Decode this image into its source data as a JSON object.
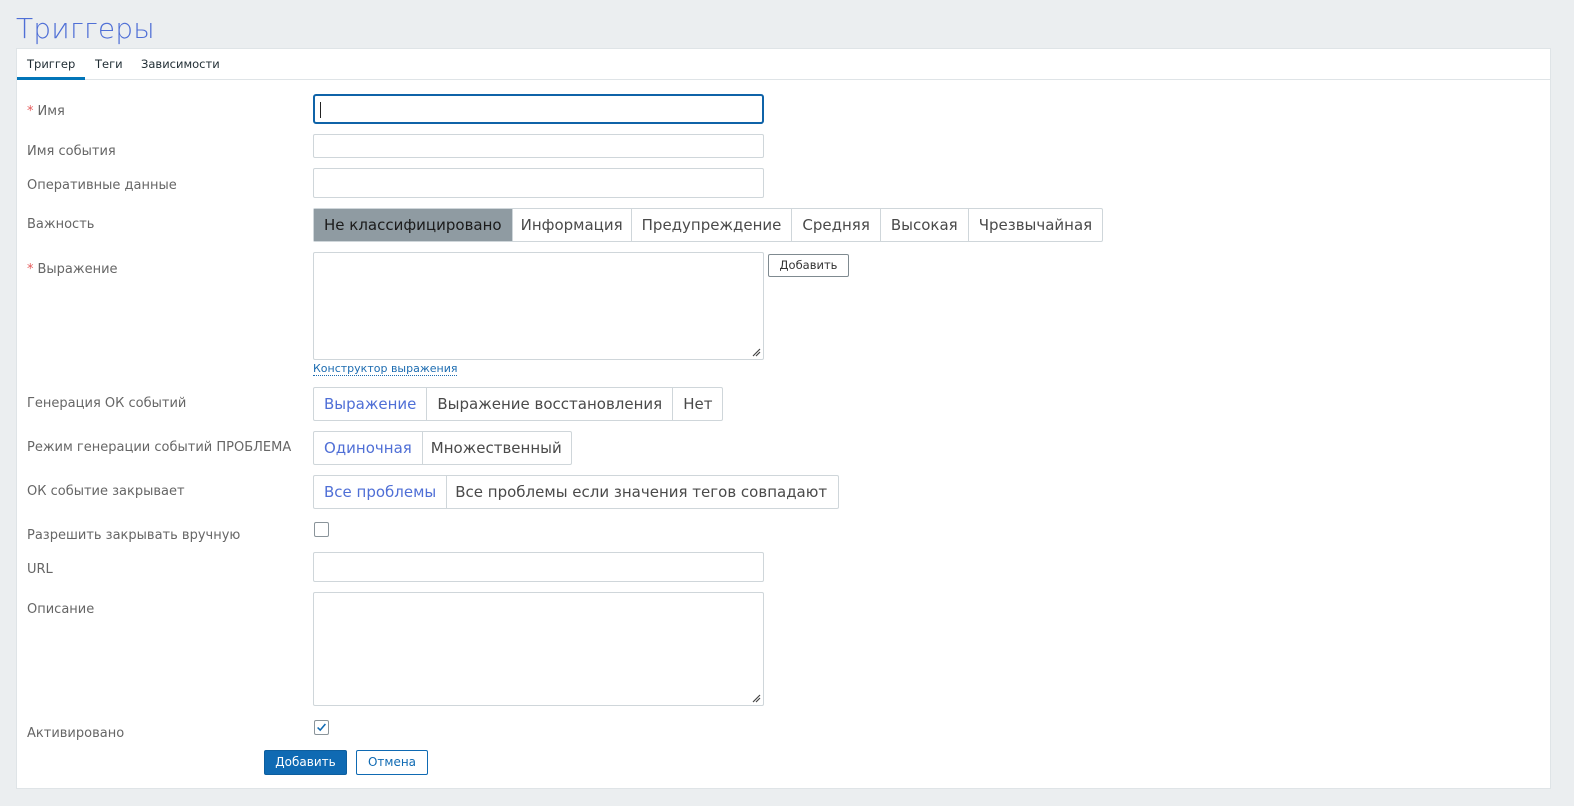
{
  "page": {
    "title": "Триггеры"
  },
  "tabs": [
    {
      "label": "Триггер",
      "active": true
    },
    {
      "label": "Теги"
    },
    {
      "label": "Зависимости"
    }
  ],
  "form": {
    "name": {
      "label": "Имя",
      "required": true,
      "value": ""
    },
    "event_name": {
      "label": "Имя события",
      "value": ""
    },
    "opdata": {
      "label": "Оперативные данные",
      "value": ""
    },
    "severity": {
      "label": "Важность",
      "options": [
        "Не классифицировано",
        "Информация",
        "Предупреждение",
        "Средняя",
        "Высокая",
        "Чрезвычайная"
      ],
      "selected": "Не классифицировано"
    },
    "expression": {
      "label": "Выражение",
      "required": true,
      "value": "",
      "add_button": "Добавить",
      "constructor_link": "Конструктор выражения"
    },
    "ok_event_generation": {
      "label": "Генерация ОК событий",
      "options": [
        "Выражение",
        "Выражение восстановления",
        "Нет"
      ],
      "selected": "Выражение"
    },
    "problem_mode": {
      "label": "Режим генерации событий ПРОБЛЕМА",
      "options": [
        "Одиночная",
        "Множественный"
      ],
      "selected": "Одиночная"
    },
    "ok_closes": {
      "label": "ОК событие закрывает",
      "options": [
        "Все проблемы",
        "Все проблемы если значения тегов совпадают"
      ],
      "selected": "Все проблемы"
    },
    "manual_close": {
      "label": "Разрешить закрывать вручную",
      "checked": false
    },
    "url": {
      "label": "URL",
      "value": ""
    },
    "description": {
      "label": "Описание",
      "value": ""
    },
    "enabled": {
      "label": "Активировано",
      "checked": true
    }
  },
  "actions": {
    "submit": "Добавить",
    "cancel": "Отмена"
  },
  "colors": {
    "accent": "#0f6ab3",
    "title": "#4f6fd6",
    "selected_gray": "#8f9ba2"
  }
}
